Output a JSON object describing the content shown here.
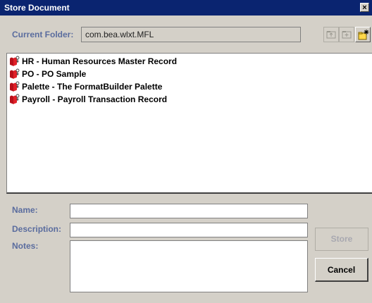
{
  "window": {
    "title": "Store Document"
  },
  "folder": {
    "label": "Current Folder:",
    "value": "com.bea.wlxt.MFL"
  },
  "toolbar": {
    "icons": [
      "folder-up-icon",
      "new-folder-icon",
      "new-item-icon"
    ]
  },
  "items": [
    {
      "label": "HR - Human Resources Master Record"
    },
    {
      "label": "PO - PO Sample"
    },
    {
      "label": "Palette - The FormatBuilder Palette"
    },
    {
      "label": "Payroll - Payroll Transaction Record"
    }
  ],
  "form": {
    "name_label": "Name:",
    "name_value": "",
    "description_label": "Description:",
    "description_value": "",
    "notes_label": "Notes:",
    "notes_value": ""
  },
  "buttons": {
    "store": "Store",
    "cancel": "Cancel"
  }
}
